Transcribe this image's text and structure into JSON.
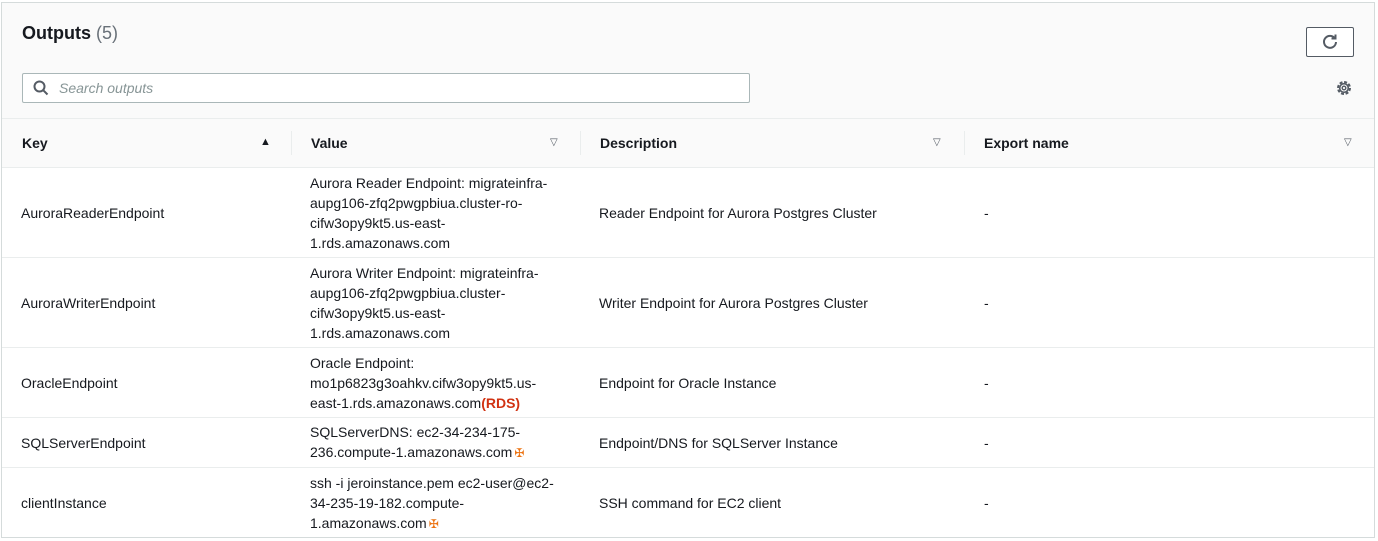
{
  "header": {
    "title": "Outputs",
    "count": "(5)",
    "refresh_icon": "refresh-icon",
    "settings_icon": "gear-icon"
  },
  "search": {
    "placeholder": "Search outputs",
    "value": ""
  },
  "table": {
    "columns": [
      {
        "label": "Key",
        "sort": "ascending"
      },
      {
        "label": "Value",
        "sort": "none"
      },
      {
        "label": "Description",
        "sort": "none"
      },
      {
        "label": "Export name",
        "sort": "none"
      }
    ],
    "rows": [
      {
        "key": "AuroraReaderEndpoint",
        "value_lines": [
          "Aurora Reader Endpoint: migrateinfra-",
          "aupg106-zfq2pwgpbiua.cluster-ro-",
          "cifw3opy9kt5.us-east-",
          "1.rds.amazonaws.com"
        ],
        "value_suffix": "",
        "description": "Reader Endpoint for Aurora Postgres Cluster",
        "export": "-"
      },
      {
        "key": "AuroraWriterEndpoint",
        "value_lines": [
          "Aurora Writer Endpoint: migrateinfra-",
          "aupg106-zfq2pwgpbiua.cluster-",
          "cifw3opy9kt5.us-east-",
          "1.rds.amazonaws.com"
        ],
        "value_suffix": "",
        "description": "Writer Endpoint for Aurora Postgres Cluster",
        "export": "-"
      },
      {
        "key": "OracleEndpoint",
        "value_lines": [
          "Oracle Endpoint:",
          "mo1p6823g3oahkv.cifw3opy9kt5.us-",
          "east-1.rds.amazonaws.com"
        ],
        "value_suffix": "(RDS)",
        "description": "Endpoint for Oracle Instance",
        "export": "-"
      },
      {
        "key": "SQLServerEndpoint",
        "value_lines": [
          "SQLServerDNS: ec2-34-234-175-",
          "236.compute-1.amazonaws.com"
        ],
        "value_suffix": "✠",
        "description": "Endpoint/DNS for SQLServer Instance",
        "export": "-"
      },
      {
        "key": "clientInstance",
        "value_lines": [
          "ssh -i jeroinstance.pem ec2-user@ec2-",
          "34-235-19-182.compute-",
          "1.amazonaws.com"
        ],
        "value_suffix": "✠",
        "description": "SSH command for EC2 client",
        "export": "-"
      }
    ]
  },
  "colors": {
    "rds_label": "#d13212",
    "external_icon": "#ec7211",
    "header_bg": "#fafafa",
    "border": "#eaeded"
  }
}
